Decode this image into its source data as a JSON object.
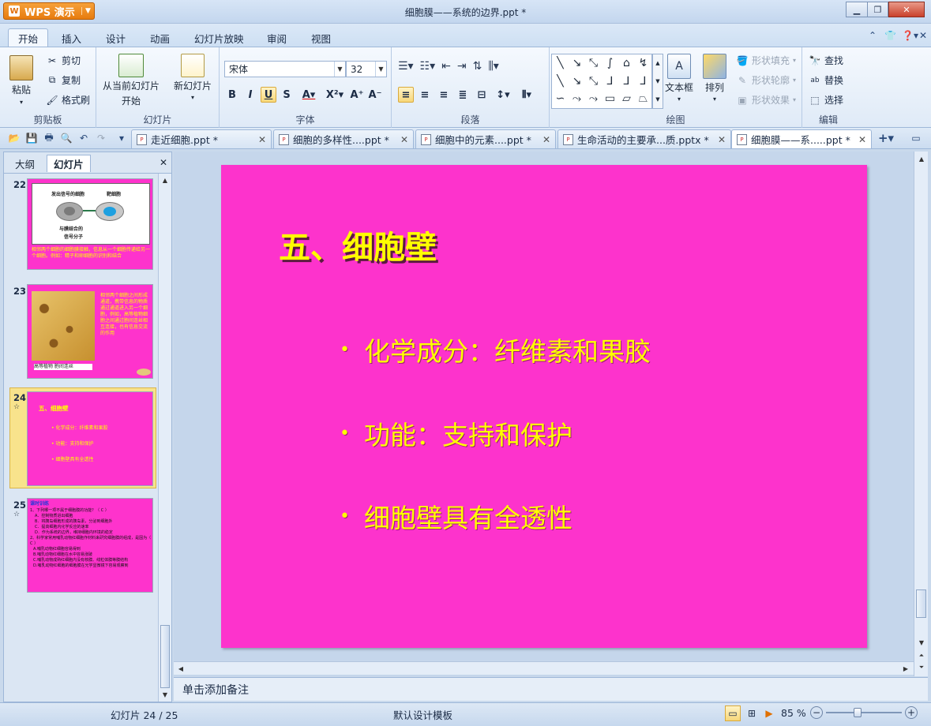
{
  "window": {
    "app_button": "WPS 演示",
    "title": "细胞膜——系统的边界.ppt *"
  },
  "menu": {
    "tabs": [
      "开始",
      "插入",
      "设计",
      "动画",
      "幻灯片放映",
      "审阅",
      "视图"
    ],
    "active": "开始"
  },
  "ribbon": {
    "clipboard": {
      "paste": "粘贴",
      "cut": "剪切",
      "copy": "复制",
      "format_painter": "格式刷",
      "group_label": "剪贴板"
    },
    "slides": {
      "from_current": "从当前幻灯片",
      "start": "开始",
      "new_slide": "新幻灯片",
      "group_label": "幻灯片"
    },
    "font": {
      "family": "宋体",
      "size": "32",
      "group_label": "字体"
    },
    "paragraph": {
      "group_label": "段落"
    },
    "drawing": {
      "text_box": "文本框",
      "arrange": "排列",
      "shape_fill": "形状填充",
      "shape_outline": "形状轮廓",
      "shape_effect": "形状效果",
      "group_label": "绘图"
    },
    "edit": {
      "find": "查找",
      "replace": "替换",
      "select": "选择",
      "group_label": "编辑"
    }
  },
  "doc_tabs": [
    {
      "label": "走近细胞.ppt *"
    },
    {
      "label": "细胞的多样性....ppt *"
    },
    {
      "label": "细胞中的元素....ppt *"
    },
    {
      "label": "生命活动的主要承...质.pptx *"
    },
    {
      "label": "细胞膜——系.....ppt *"
    }
  ],
  "left_panel": {
    "tabs": [
      "大纲",
      "幻灯片"
    ],
    "active": "幻灯片",
    "slides": [
      {
        "num": "22",
        "lines": [
          "发出信号的细胞",
          "靶细胞",
          "与膜结合的",
          "信号分子",
          "相邻两个细胞的细胞膜接触，信息从一个细胞传递给另一个细胞。例如：精子和卵细胞的识别和结合"
        ]
      },
      {
        "num": "23",
        "lines": [
          "相邻两个细胞之间形成通道，携带信息的物质通过通道进入另一个细胞，例如，高等植物细胞之间通过胞间连丝相互连接，也有信息交流的作用",
          "高等植物 胞间连丝"
        ]
      },
      {
        "num": "24",
        "mark": "☆",
        "lines": [
          "五、细胞壁",
          "化学成分：纤维素和果胶",
          "功能：支持和保护",
          "细胞壁具有全透性"
        ]
      },
      {
        "num": "25",
        "mark": "☆",
        "lines": [
          "课时训练",
          "1、下列哪一项不属于细胞膜的功能？（ C ）",
          "A．控制物质进出细胞",
          "B．将胰岛细胞形成的胰岛素，分泌到细胞外",
          "C．提高细胞内化学反应的速率",
          "D．作为系统的边界，维持细胞内环境的稳定",
          "2、科学家常用哺乳动物红细胞作材料来研究细胞膜的组成，是因为（ C ）",
          "A.哺乳动物红细胞容易得到",
          "B.哺乳动物红细胞在水中容易涨破",
          "C.哺乳动物成熟红细胞内没有核膜、线粒体膜等膜结构",
          "D.哺乳动物红细胞的细胞膜在光学显微镜下容易观察到"
        ]
      }
    ]
  },
  "slide": {
    "title": "五、细胞壁",
    "bullets": [
      "化学成分：纤维素和果胶",
      "功能：支持和保护",
      "细胞壁具有全透性"
    ],
    "background": "#fd33cc",
    "text_color": "#ffff00"
  },
  "notes_placeholder": "单击添加备注",
  "status": {
    "slide_counter": "幻灯片 24 / 25",
    "template": "默认设计模板",
    "zoom": "85 %",
    "zoom_level_percent": 85
  }
}
